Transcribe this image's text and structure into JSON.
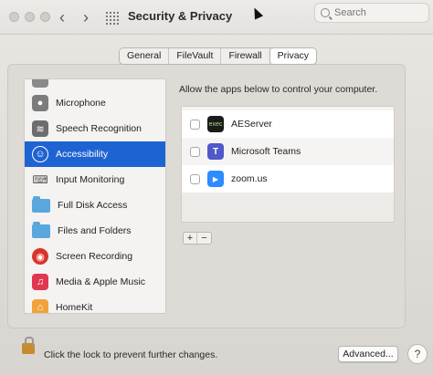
{
  "window": {
    "title": "Security & Privacy",
    "search_placeholder": "Search"
  },
  "tabs": [
    {
      "label": "General",
      "active": false
    },
    {
      "label": "FileVault",
      "active": false
    },
    {
      "label": "Firewall",
      "active": false
    },
    {
      "label": "Privacy",
      "active": true
    }
  ],
  "sidebar": {
    "items": [
      {
        "label": "Microphone",
        "icon": "microphone-icon",
        "selected": false
      },
      {
        "label": "Speech Recognition",
        "icon": "speech-recognition-icon",
        "selected": false
      },
      {
        "label": "Accessibility",
        "icon": "accessibility-icon",
        "selected": true
      },
      {
        "label": "Input Monitoring",
        "icon": "keyboard-icon",
        "selected": false
      },
      {
        "label": "Full Disk Access",
        "icon": "folder-icon",
        "selected": false
      },
      {
        "label": "Files and Folders",
        "icon": "folder-icon",
        "selected": false
      },
      {
        "label": "Screen Recording",
        "icon": "screen-recording-icon",
        "selected": false
      },
      {
        "label": "Media & Apple Music",
        "icon": "music-icon",
        "selected": false
      },
      {
        "label": "HomeKit",
        "icon": "home-icon",
        "selected": false
      }
    ]
  },
  "panel": {
    "description": "Allow the apps below to control your computer.",
    "apps": [
      {
        "name": "AEServer",
        "checked": false,
        "icon": "terminal-icon",
        "icon_text": "exec"
      },
      {
        "name": "Microsoft Teams",
        "checked": false,
        "icon": "teams-icon",
        "icon_text": "T"
      },
      {
        "name": "zoom.us",
        "checked": false,
        "icon": "zoom-icon",
        "icon_text": "▶"
      }
    ],
    "add_label": "+",
    "remove_label": "−"
  },
  "footer": {
    "lock_text": "Click the lock to prevent further changes.",
    "advanced_label": "Advanced...",
    "help_label": "?"
  },
  "colors": {
    "selection": "#1e63d2",
    "teams": "#5059c9",
    "zoom": "#2d8cff",
    "screen_recording": "#d9342b",
    "music": "#e0364f",
    "homekit": "#f2a23a"
  }
}
